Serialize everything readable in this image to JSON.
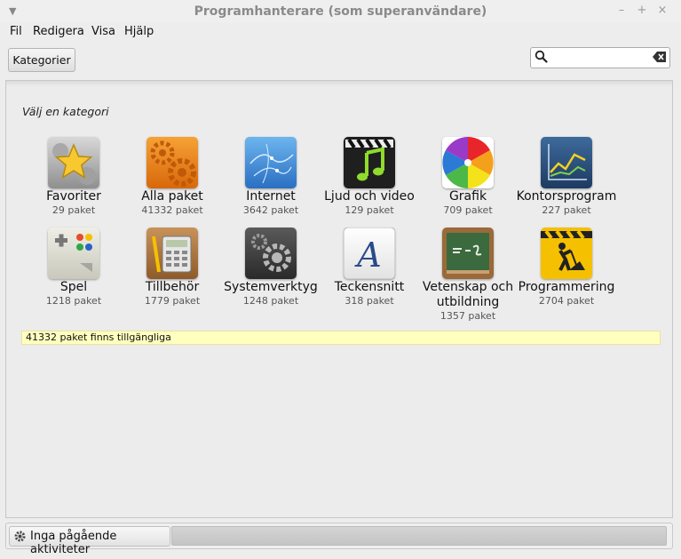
{
  "window": {
    "title": "Programhanterare (som superanvändare)",
    "controls": {
      "minimize": "–",
      "maximize": "+",
      "close": "×"
    }
  },
  "menubar": [
    "Fil",
    "Redigera",
    "Visa",
    "Hjälp"
  ],
  "toolbar": {
    "categories_button": "Kategorier",
    "search": {
      "value": "",
      "placeholder": ""
    }
  },
  "main": {
    "heading": "Välj en kategori",
    "categories": [
      {
        "name": "Favoriter",
        "count": "29 paket",
        "icon": "star-icon"
      },
      {
        "name": "Alla paket",
        "count": "41332 paket",
        "icon": "gears-icon"
      },
      {
        "name": "Internet",
        "count": "3642 paket",
        "icon": "globe-icon"
      },
      {
        "name": "Ljud och video",
        "count": "129 paket",
        "icon": "clapper-note-icon"
      },
      {
        "name": "Grafik",
        "count": "709 paket",
        "icon": "color-wheel-icon"
      },
      {
        "name": "Kontorsprogram",
        "count": "227 paket",
        "icon": "chart-board-icon"
      },
      {
        "name": "Spel",
        "count": "1218 paket",
        "icon": "gamepad-icon"
      },
      {
        "name": "Tillbehör",
        "count": "1779 paket",
        "icon": "calculator-icon"
      },
      {
        "name": "Systemverktyg",
        "count": "1248 paket",
        "icon": "system-gear-icon"
      },
      {
        "name": "Teckensnitt",
        "count": "318 paket",
        "icon": "font-icon"
      },
      {
        "name": "Vetenskap och utbildning",
        "count": "1357 paket",
        "icon": "chalkboard-icon"
      },
      {
        "name": "Programmering",
        "count": "2704 paket",
        "icon": "roadwork-icon"
      }
    ],
    "status": "41332 paket finns tillgängliga"
  },
  "bottombar": {
    "activity_label": "Inga pågående aktiviteter",
    "progress": 0
  }
}
